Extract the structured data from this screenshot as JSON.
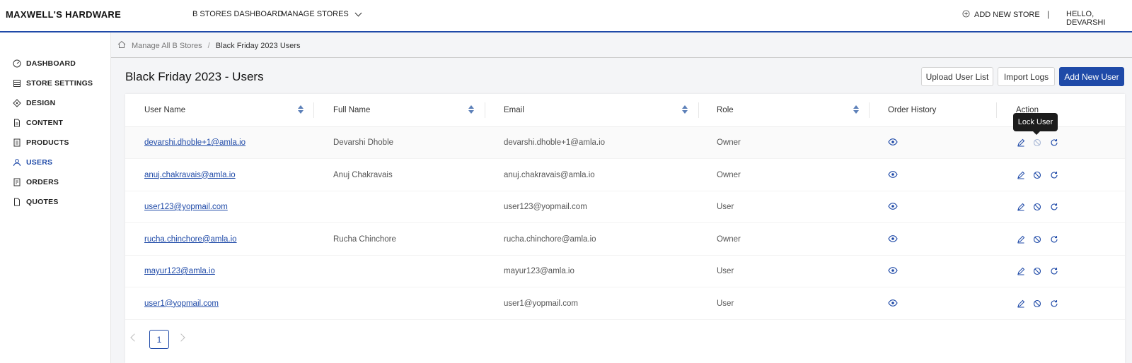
{
  "app": {
    "brand": "MAXWELL'S HARDWARE",
    "nav": {
      "dashboard": "B STORES DASHBOARD",
      "manage_stores": "MANAGE STORES",
      "add_store": "ADD NEW STORE",
      "separator": "|",
      "greeting": "HELLO, DEVARSHI"
    }
  },
  "sidebar": {
    "items": [
      {
        "label": "DASHBOARD",
        "icon": "dashboard-icon"
      },
      {
        "label": "STORE SETTINGS",
        "icon": "settings-icon"
      },
      {
        "label": "DESIGN",
        "icon": "design-icon"
      },
      {
        "label": "CONTENT",
        "icon": "content-icon"
      },
      {
        "label": "PRODUCTS",
        "icon": "products-icon"
      },
      {
        "label": "USERS",
        "icon": "user-icon",
        "active": true
      },
      {
        "label": "ORDERS",
        "icon": "orders-icon"
      },
      {
        "label": "QUOTES",
        "icon": "quotes-icon"
      }
    ]
  },
  "breadcrumb": {
    "home_icon": "home-icon",
    "parent": "Manage All B Stores",
    "separator": "/",
    "current": "Black Friday 2023 Users"
  },
  "page": {
    "title": "Black Friday 2023 - Users",
    "buttons": {
      "upload": "Upload User List",
      "import": "Import Logs",
      "add": "Add New User"
    }
  },
  "table": {
    "columns": [
      "User Name",
      "Full Name",
      "Email",
      "Role",
      "Order History",
      "Action"
    ],
    "rows": [
      {
        "username": "devarshi.dhoble+1@amla.io",
        "fullname": "Devarshi Dhoble",
        "email": "devarshi.dhoble+1@amla.io",
        "role": "Owner"
      },
      {
        "username": "anuj.chakravais@amla.io",
        "fullname": "Anuj Chakravais",
        "email": "anuj.chakravais@amla.io",
        "role": "Owner"
      },
      {
        "username": "user123@yopmail.com",
        "fullname": "",
        "email": "user123@yopmail.com",
        "role": "User"
      },
      {
        "username": "rucha.chinchore@amla.io",
        "fullname": "Rucha Chinchore",
        "email": "rucha.chinchore@amla.io",
        "role": "Owner"
      },
      {
        "username": "mayur123@amla.io",
        "fullname": "",
        "email": "mayur123@amla.io",
        "role": "User"
      },
      {
        "username": "user1@yopmail.com",
        "fullname": "",
        "email": "user1@yopmail.com",
        "role": "User"
      }
    ]
  },
  "tooltip": "Lock User",
  "pagination": {
    "current_page": "1"
  },
  "colors": {
    "accent": "#1f4aa8"
  }
}
